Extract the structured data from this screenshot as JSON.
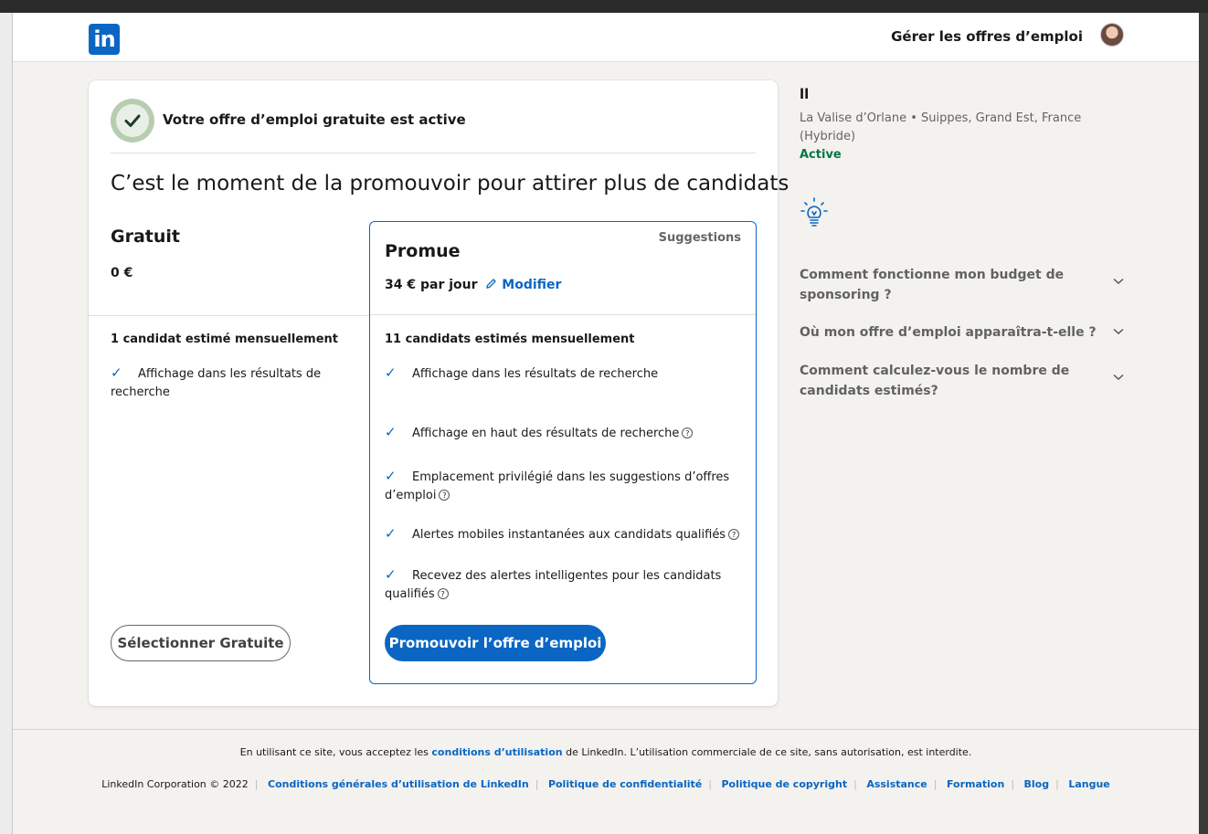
{
  "header": {
    "logo": "in",
    "manage_jobs": "Gérer les offres d’emploi"
  },
  "status": {
    "message": "Votre offre d’emploi gratuite est active"
  },
  "headline": "C’est le moment de la promouvoir pour attirer plus de candidats",
  "free_plan": {
    "title": "Gratuit",
    "price": "0 €",
    "estimate": "1 candidat estimé mensuellement",
    "features": [
      "Affichage dans les résultats de recherche"
    ],
    "button": "Sélectionner Gratuite"
  },
  "promo_plan": {
    "badge": "Suggestions",
    "title": "Promue",
    "price": "34 € par jour",
    "modify": "Modifier",
    "estimate": "11 candidats estimés mensuellement",
    "features": [
      "Affichage dans les résultats de recherche",
      "Affichage en haut des résultats de recherche",
      "Emplacement privilégié dans les suggestions d’offres d’emploi",
      "Alertes mobiles instantanées aux candidats qualifiés",
      "Recevez des alertes intelligentes pour les candidats qualifiés"
    ],
    "button": "Promouvoir l’offre d’emploi"
  },
  "job": {
    "title": "ll",
    "meta": "La Valise d’Orlane • Suippes, Grand Est, France (Hybride)",
    "status": "Active"
  },
  "faq": [
    "Comment fonctionne mon budget de sponsoring ?",
    "Où mon offre d’emploi apparaîtra-t-elle ?",
    "Comment calculez-vous le nombre de candidats estimés?"
  ],
  "footer": {
    "terms_pre": "En utilisant ce site, vous acceptez les",
    "terms_link": "conditions d’utilisation",
    "terms_post": "de LinkedIn. L’utilisation commerciale de ce site, sans autorisation, est interdite.",
    "copyright": "LinkedIn Corporation © 2022",
    "links": [
      "Conditions générales d’utilisation de LinkedIn",
      "Politique de confidentialité",
      "Politique de copyright",
      "Assistance",
      "Formation",
      "Blog",
      "Langue"
    ]
  },
  "colors": {
    "brand": "#0a66c2",
    "active": "#057642",
    "background": "#f3f2ef"
  }
}
